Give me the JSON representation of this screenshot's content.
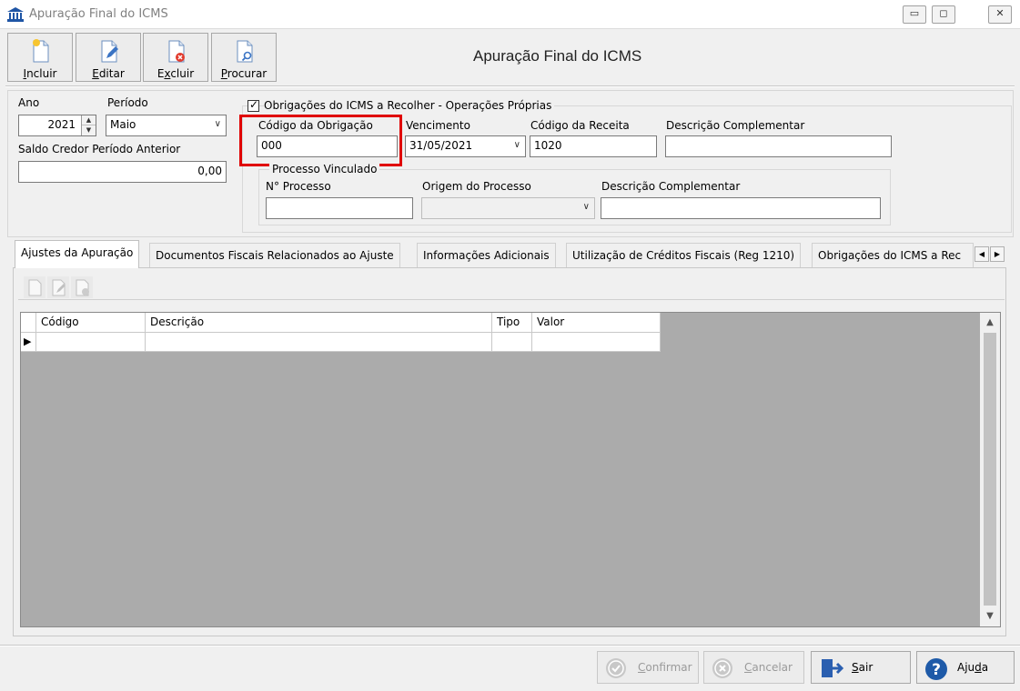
{
  "window": {
    "title": "Apuração Final do ICMS",
    "controls": {
      "minimize": "▭",
      "maximize": "◻",
      "close": "✕"
    }
  },
  "toolbar": {
    "incluir": {
      "label_before": "",
      "accel": "I",
      "label_after": "ncluir"
    },
    "editar": {
      "label_before": "",
      "accel": "E",
      "label_after": "ditar"
    },
    "excluir": {
      "label_before": "E",
      "accel": "x",
      "label_after": "cluir"
    },
    "procurar": {
      "label_before": "",
      "accel": "P",
      "label_after": "rocurar"
    }
  },
  "form_title": "Apuração Final do ICMS",
  "header": {
    "ano_label": "Ano",
    "ano_value": "2021",
    "periodo_label": "Período",
    "periodo_value": "Maio",
    "saldo_label": "Saldo Credor Período Anterior",
    "saldo_value": "0,00"
  },
  "obrigacoes": {
    "group_label": "Obrigações do ICMS a Recolher - Operações Próprias",
    "checked": true,
    "check_mark": "✓",
    "codigo_label": "Código da Obrigação",
    "codigo_value": "000",
    "vencimento_label": "Vencimento",
    "vencimento_value": "31/05/2021",
    "receita_label": "Código da Receita",
    "receita_value": "1020",
    "descricao_label": "Descrição Complementar",
    "descricao_value": ""
  },
  "processo": {
    "group_label": "Processo Vinculado",
    "numero_label": "N° Processo",
    "numero_value": "",
    "origem_label": "Origem do Processo",
    "origem_value": "",
    "descricao_label": "Descrição Complementar",
    "descricao_value": ""
  },
  "tabs": [
    {
      "label": "Ajustes da Apuração",
      "active": true
    },
    {
      "label": "Documentos Fiscais Relacionados ao Ajuste",
      "active": false
    },
    {
      "label": "Informações Adicionais",
      "active": false
    },
    {
      "label": "Utilização de Créditos Fiscais (Reg 1210)",
      "active": false
    },
    {
      "label": "Obrigações do ICMS a Rec",
      "active": false
    }
  ],
  "tab_arrows": {
    "left": "◀",
    "right": "▶"
  },
  "grid": {
    "columns": [
      "Código",
      "Descrição",
      "Tipo",
      "Valor"
    ],
    "row_indicator": "▶",
    "rows": [
      [
        "",
        "",
        "",
        ""
      ]
    ],
    "scroll_up": "▲",
    "scroll_down": "▼"
  },
  "footer": {
    "confirmar": {
      "label_before": "",
      "accel": "C",
      "label_after": "onfirmar",
      "enabled": false
    },
    "cancelar": {
      "label_before": "",
      "accel": "C",
      "label_after": "ancelar",
      "enabled": false
    },
    "sair": {
      "label_before": "",
      "accel": "S",
      "label_after": "air",
      "enabled": true
    },
    "ajuda": {
      "label_before": "Aju",
      "accel": "d",
      "label_after": "a",
      "enabled": true
    }
  },
  "colors": {
    "highlight": "#e00000",
    "help_blue": "#1e5aa8",
    "exit_blue": "#2b5fb0"
  }
}
